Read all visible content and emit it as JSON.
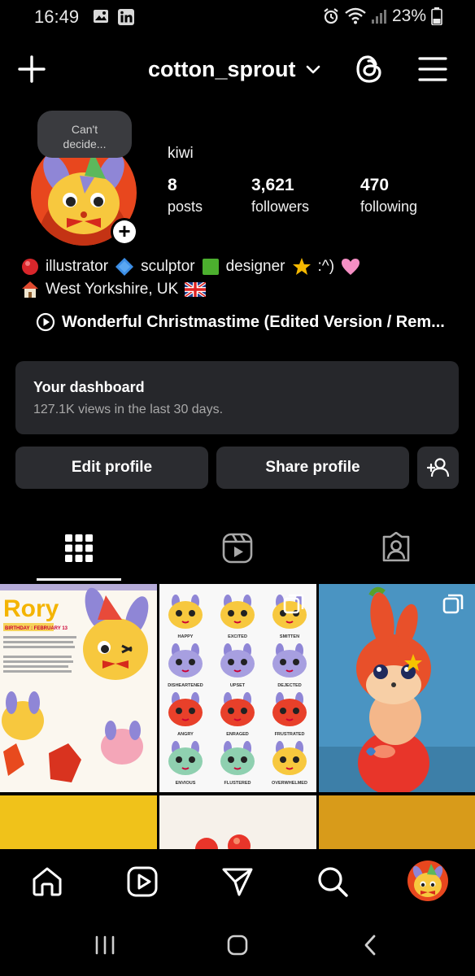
{
  "status": {
    "time": "16:49",
    "battery": "23%"
  },
  "header": {
    "username": "cotton_sprout"
  },
  "note": {
    "text_line1": "Can't",
    "text_line2": "decide..."
  },
  "profile": {
    "display_name": "kiwi",
    "stats": [
      {
        "value": "8",
        "label": "posts"
      },
      {
        "value": "3,621",
        "label": "followers"
      },
      {
        "value": "470",
        "label": "following"
      }
    ],
    "bio_line1_parts": [
      "illustrator",
      "sculptor",
      "designer",
      ":^)"
    ],
    "bio_line2": "West Yorkshire, UK",
    "music": "Wonderful Christmastime (Edited Version / Rem..."
  },
  "dashboard": {
    "title": "Your dashboard",
    "subtitle": "127.1K views in the last 30 days."
  },
  "actions": {
    "edit": "Edit profile",
    "share": "Share profile"
  },
  "posts": {
    "post1_title": "Rory",
    "post1_caption": "BIRTHDAY : FEBRUARY 13",
    "emotions": [
      "HAPPY",
      "EXCITED",
      "SMITTEN",
      "DISHEARTENED",
      "UPSET",
      "DEJECTED",
      "ANGRY",
      "ENRAGED",
      "FRUSTRATED",
      "ENVIOUS",
      "FLUSTERED",
      "OVERWHELMED"
    ]
  },
  "colors": {
    "background": "#000000",
    "card": "#26272b",
    "button": "#2b2c30",
    "accent_orange": "#e8471e"
  }
}
